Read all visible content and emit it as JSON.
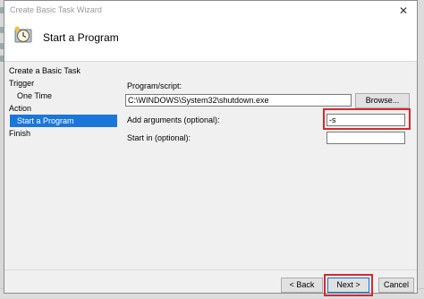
{
  "window": {
    "title": "Create Basic Task Wizard",
    "close_glyph": "✕"
  },
  "header": {
    "title": "Start a Program"
  },
  "nav": {
    "items": [
      {
        "label": "Create a Basic Task"
      },
      {
        "label": "Trigger"
      },
      {
        "label": "One Time"
      },
      {
        "label": "Action"
      },
      {
        "label": "Start a Program"
      },
      {
        "label": "Finish"
      }
    ]
  },
  "form": {
    "program_label": "Program/script:",
    "program_value": "C:\\WINDOWS\\System32\\shutdown.exe",
    "browse_label": "Browse...",
    "args_label": "Add arguments (optional):",
    "args_value": "-s",
    "startin_label": "Start in (optional):",
    "startin_value": ""
  },
  "buttons": {
    "back": "< Back",
    "next": "Next >",
    "cancel": "Cancel"
  },
  "colors": {
    "selection": "#1a77d9",
    "highlight": "#d8282f"
  }
}
